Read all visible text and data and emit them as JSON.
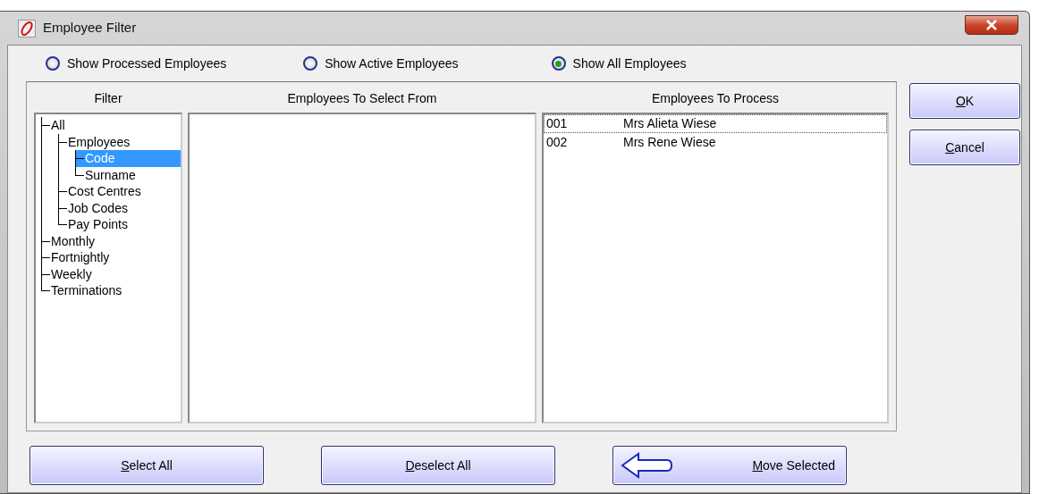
{
  "window": {
    "title": "Employee Filter"
  },
  "radios": [
    {
      "label": "Show Processed Employees",
      "selected": false
    },
    {
      "label": "Show Active Employees",
      "selected": false
    },
    {
      "label": "Show All Employees",
      "selected": true
    }
  ],
  "filter": {
    "heading": "Filter",
    "tree": [
      {
        "label": "All",
        "selected": false,
        "children": [
          {
            "label": "Employees",
            "selected": false,
            "children": [
              {
                "label": "Code",
                "selected": true
              },
              {
                "label": "Surname",
                "selected": false
              }
            ]
          },
          {
            "label": "Cost Centres",
            "selected": false
          },
          {
            "label": "Job Codes",
            "selected": false
          },
          {
            "label": "Pay Points",
            "selected": false
          }
        ]
      },
      {
        "label": "Monthly",
        "selected": false
      },
      {
        "label": "Fortnightly",
        "selected": false
      },
      {
        "label": "Weekly",
        "selected": false
      },
      {
        "label": "Terminations",
        "selected": false
      }
    ]
  },
  "select_from": {
    "heading": "Employees To Select From"
  },
  "to_process": {
    "heading": "Employees To Process",
    "rows": [
      {
        "code": "001",
        "name": "Mrs Alieta Wiese",
        "focused": true
      },
      {
        "code": "002",
        "name": "Mrs Rene Wiese",
        "focused": false
      }
    ]
  },
  "side_buttons": [
    {
      "key": "O",
      "rest": "K"
    },
    {
      "key": "C",
      "rest": "ancel"
    }
  ],
  "bottom_buttons": [
    {
      "kind": "plain",
      "key": "S",
      "rest": "elect All"
    },
    {
      "kind": "plain",
      "key": "D",
      "rest": "eselect All"
    },
    {
      "kind": "arrow",
      "key": "M",
      "rest": "ove Selected"
    }
  ]
}
